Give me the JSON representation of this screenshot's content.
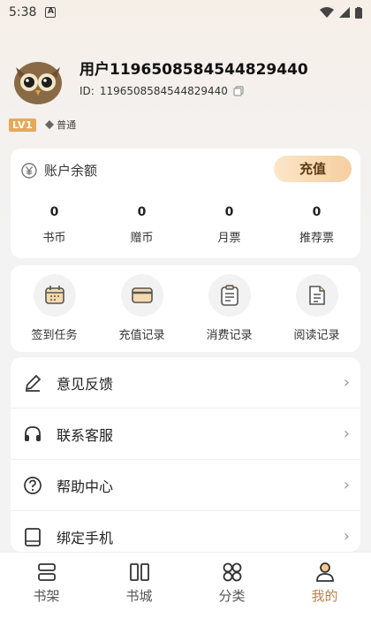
{
  "status_bar": {
    "time": "5:38"
  },
  "profile": {
    "username": "用户1196508584544829440",
    "id_label": "ID:",
    "id_value": "1196508584544829440",
    "level": "LV1",
    "tier": "普通"
  },
  "balance": {
    "title": "账户余额",
    "recharge_label": "充值",
    "stats": [
      {
        "value": "0",
        "label": "书币"
      },
      {
        "value": "0",
        "label": "赠币"
      },
      {
        "value": "0",
        "label": "月票"
      },
      {
        "value": "0",
        "label": "推荐票"
      }
    ]
  },
  "actions": [
    {
      "label": "签到任务",
      "icon": "calendar-icon"
    },
    {
      "label": "充值记录",
      "icon": "card-icon"
    },
    {
      "label": "消费记录",
      "icon": "clipboard-icon"
    },
    {
      "label": "阅读记录",
      "icon": "document-icon"
    }
  ],
  "menu": [
    {
      "label": "意见反馈",
      "icon": "pen-icon"
    },
    {
      "label": "联系客服",
      "icon": "headset-icon"
    },
    {
      "label": "帮助中心",
      "icon": "help-icon"
    },
    {
      "label": "绑定手机",
      "icon": "phone-icon"
    }
  ],
  "nav": [
    {
      "label": "书架",
      "icon": "shelf-icon"
    },
    {
      "label": "书城",
      "icon": "store-icon"
    },
    {
      "label": "分类",
      "icon": "category-icon"
    },
    {
      "label": "我的",
      "icon": "user-icon",
      "active": true
    }
  ],
  "colors": {
    "accent": "#b9854d",
    "recharge_bg": "#f5cfa0",
    "level_badge": "#e7a958"
  }
}
